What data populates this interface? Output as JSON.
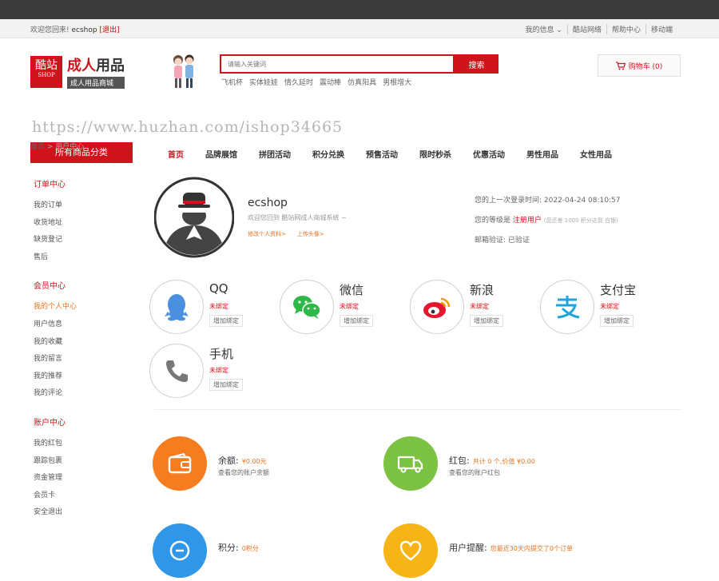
{
  "infobar": {
    "welcome": "欢迎您回来!",
    "username": "ecshop",
    "logout": "[退出]",
    "links": [
      "我的信息 ⌄",
      "酷站网络",
      "帮助中心",
      "移动端"
    ]
  },
  "logo": {
    "mark": "酷站",
    "mark_sub": "SHOP",
    "title_red": "成人",
    "title_dark": "用品",
    "subtitle": "成人用品商城"
  },
  "search": {
    "placeholder": "请输入关键词",
    "button": "搜索",
    "hotwords": [
      "飞机杯",
      "实体娃娃",
      "情久延时",
      "震动棒",
      "仿真阳具",
      "男根增大"
    ]
  },
  "cart": {
    "label": "购物车 (0)",
    "icon": "cart-icon"
  },
  "watermark": "https://www.huzhan.com/ishop34665",
  "nav": {
    "all_categories": "所有商品分类",
    "items": [
      "首页",
      "品牌展馆",
      "拼团活动",
      "积分兑换",
      "预售活动",
      "限时秒杀",
      "优惠活动",
      "男性用品",
      "女性用品"
    ]
  },
  "breadcrumb": {
    "home": "首页",
    "sep": " > ",
    "current": "用户中心"
  },
  "sidebar": {
    "groups": [
      {
        "title": "订单中心",
        "items": [
          "我的订单",
          "收货地址",
          "缺货登记",
          "售后"
        ]
      },
      {
        "title": "会员中心",
        "items": [
          "我的个人中心",
          "用户信息",
          "我的收藏",
          "我的留言",
          "我的推荐",
          "我的评论"
        ]
      },
      {
        "title": "账户中心",
        "items": [
          "我的红包",
          "跟踪包裹",
          "资金管理",
          "会员卡",
          "安全退出"
        ]
      }
    ]
  },
  "profile": {
    "username": "ecshop",
    "slogan": "欢迎您回到 酷站网成人商城系统 ~",
    "edit_link": "修改个人资料>",
    "upload_link": "上传头像>",
    "last_login": "您的上一次登录时间: 2022-04-24 08:10:57",
    "rank_prefix": "您的等级是",
    "rank": "注册用户",
    "rank_note": "(您还差 1000 积分达到 白银)",
    "email": "邮箱验证: 已验证"
  },
  "binds": [
    {
      "name": "QQ",
      "status": "未绑定",
      "action": "增加绑定",
      "icon": "qq-icon",
      "color": "#4a8fe0"
    },
    {
      "name": "微信",
      "status": "未绑定",
      "action": "增加绑定",
      "icon": "wechat-icon",
      "color": "#2fb84a"
    },
    {
      "name": "新浪",
      "status": "未绑定",
      "action": "增加绑定",
      "icon": "weibo-icon",
      "color": "#e6162d"
    },
    {
      "name": "支付宝",
      "status": "未绑定",
      "action": "增加绑定",
      "icon": "alipay-icon",
      "color": "#1aa5e0"
    },
    {
      "name": "手机",
      "status": "未绑定",
      "action": "增加绑定",
      "icon": "phone-icon",
      "color": "#777777"
    }
  ],
  "accounts": [
    {
      "label": "余额:",
      "value": "¥0.00元",
      "desc": "查看您的账户余额",
      "icon": "wallet-icon",
      "color": "#f57c1f"
    },
    {
      "label": "红包:",
      "value": "共计 0 个,价值 ¥0.00",
      "desc": "查看您的账户红包",
      "icon": "truck-icon",
      "color": "#7cc242"
    },
    {
      "label": "积分:",
      "value": "0积分",
      "desc": "",
      "icon": "points-icon",
      "color": "#2f96e8"
    },
    {
      "label": "用户提醒:",
      "value": "您最近30天内提交了0个订单",
      "desc": "",
      "icon": "heart-icon",
      "color": "#f7b417"
    }
  ]
}
